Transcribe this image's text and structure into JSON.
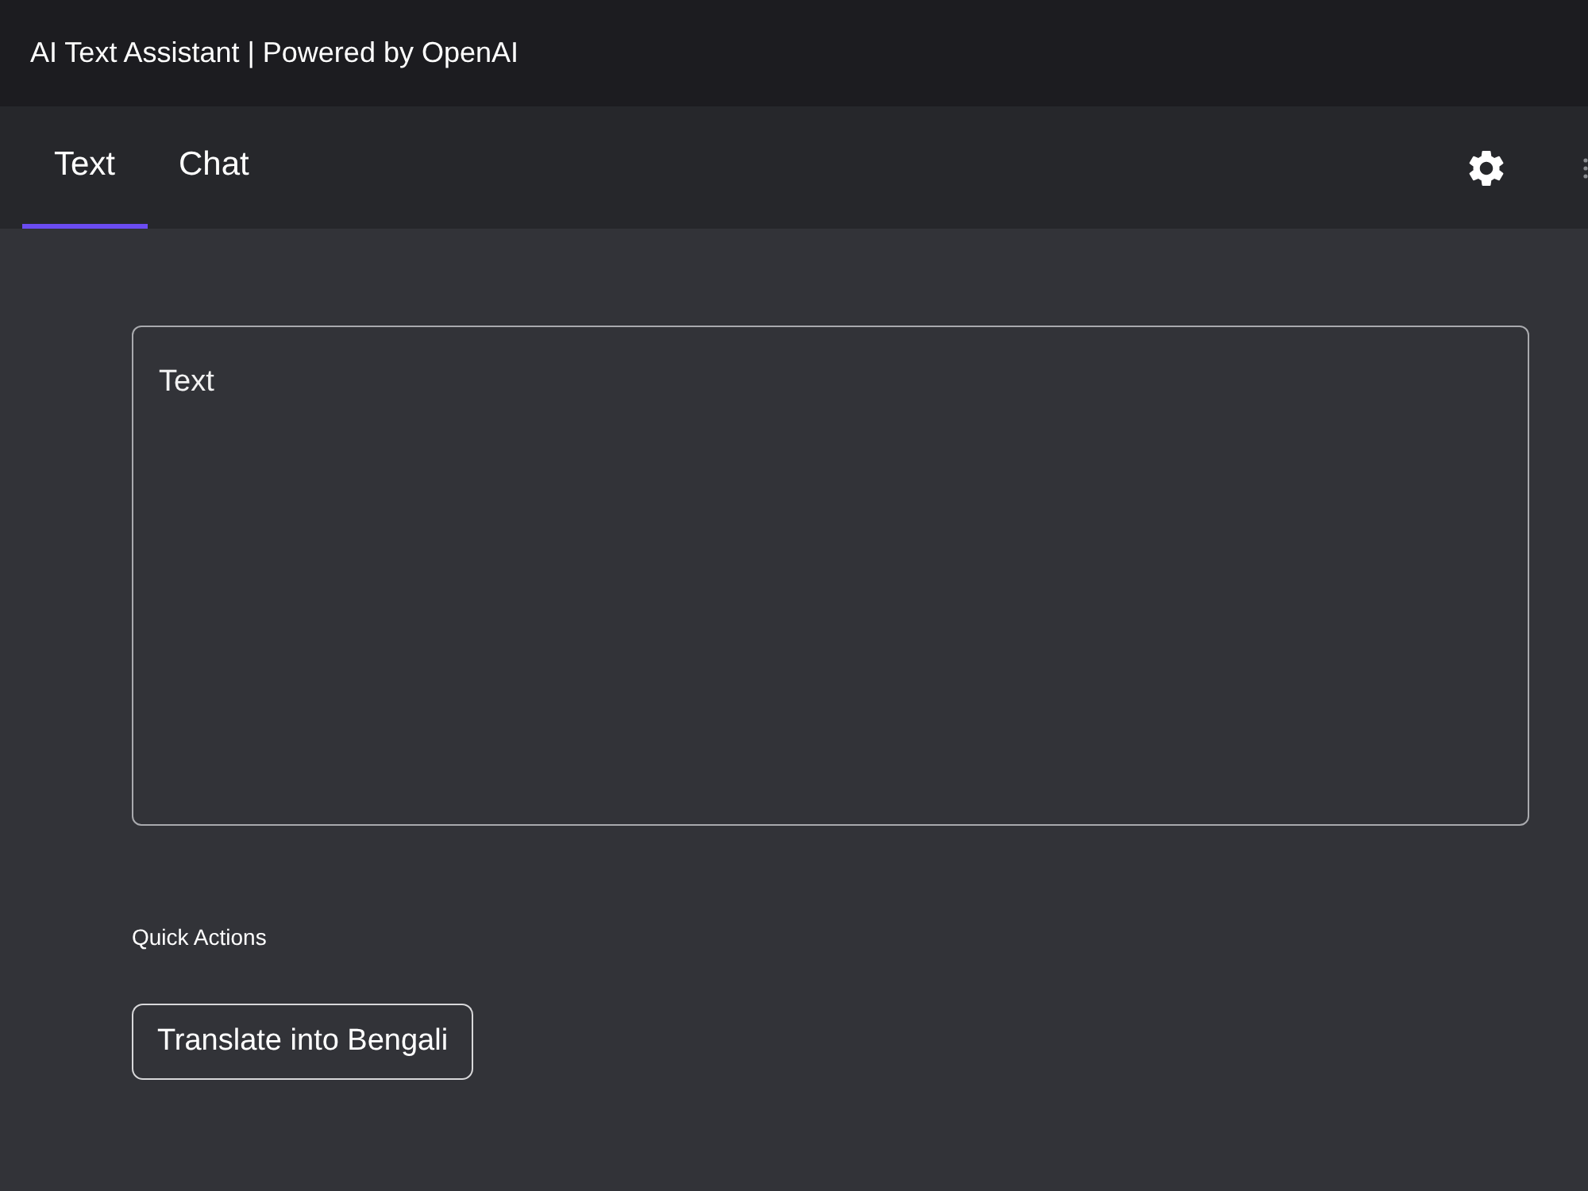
{
  "header": {
    "title": "AI Text Assistant | Powered by OpenAI"
  },
  "tabs": [
    {
      "label": "Text",
      "selected": true
    },
    {
      "label": "Chat",
      "selected": false
    }
  ],
  "text_input": {
    "placeholder": "Text"
  },
  "quick_actions": {
    "heading": "Quick Actions",
    "buttons": [
      {
        "label": "Translate into Bengali"
      }
    ]
  }
}
